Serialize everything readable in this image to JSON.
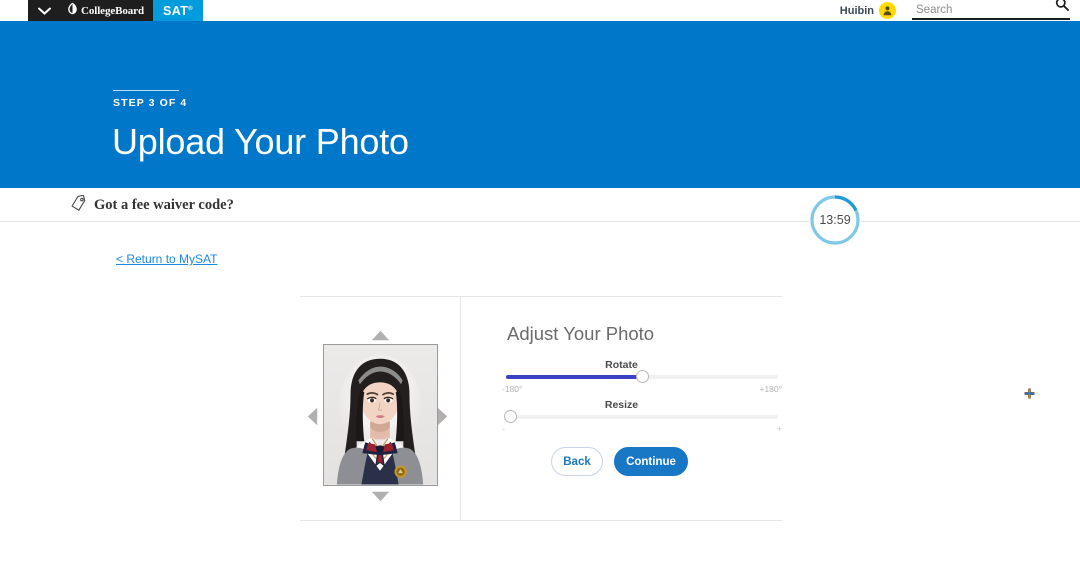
{
  "topnav": {
    "menu_icon": "chevron-down-icon",
    "collegeboard_label": "CollegeBoard",
    "acorn_icon": "acorn-logo-icon",
    "sat_label": "SAT",
    "sat_registered": "®",
    "username": "Huibin",
    "avatar_icon": "user-avatar-icon",
    "search": {
      "value": "",
      "placeholder": "Search",
      "icon": "search-icon"
    }
  },
  "hero": {
    "step": "STEP 3 OF 4",
    "title": "Upload Your Photo",
    "background_color": "#0077c8"
  },
  "fee_bar": {
    "icon": "tag-icon",
    "label": "Got a fee waiver code?",
    "plus_glyph": "plus-cursor-icon"
  },
  "timer": {
    "value": "13:59",
    "ring_color": "#7fc8e8",
    "arc_color": "#1f9cd8"
  },
  "return_link": {
    "label": "< Return to MySAT"
  },
  "editor": {
    "photo": {
      "alt_name": "user-id-photo",
      "arrows": {
        "up": "arrow-up-icon",
        "down": "arrow-down-icon",
        "left": "arrow-left-icon",
        "right": "arrow-right-icon"
      }
    },
    "title": "Adjust Your Photo",
    "sliders": [
      {
        "name": "rotate",
        "label": "Rotate",
        "min_label": "-180°",
        "max_label": "+180°",
        "value_percent": 50,
        "fill_color": "#3b43c2"
      },
      {
        "name": "resize",
        "label": "Resize",
        "min_label": "-",
        "max_label": "+",
        "value_percent": 0,
        "fill_color": "#3b43c2"
      }
    ],
    "buttons": {
      "back": "Back",
      "continue": "Continue"
    }
  }
}
